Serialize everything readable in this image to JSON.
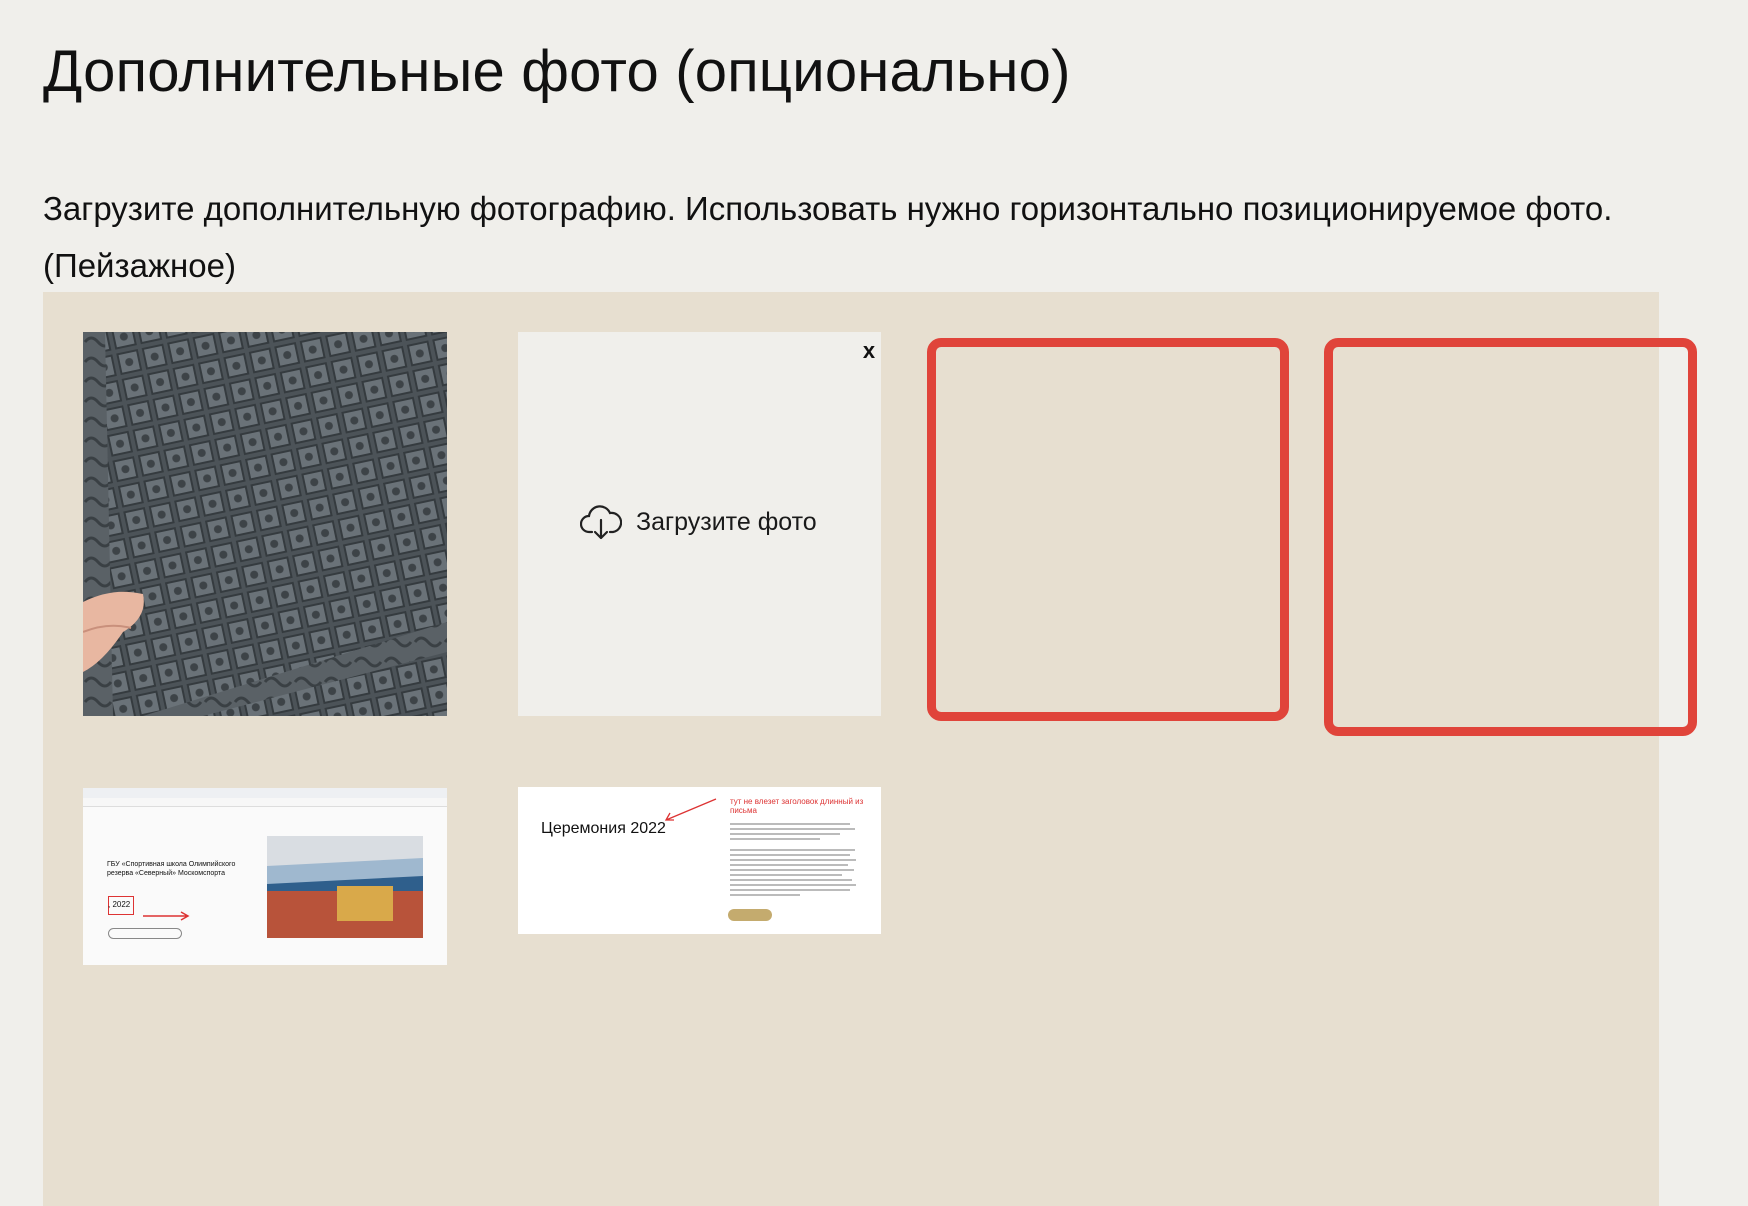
{
  "section": {
    "title": "Дополнительные фото (опционально)",
    "description": "Загрузите дополнительную фотографию. Использовать нужно горизонтально позиционируемое фото. (Пейзажное)"
  },
  "upload_slot": {
    "label": "Загрузите фото",
    "close_label": "x"
  },
  "thumbnails": {
    "screenshot_site": {
      "heading_line1": "ГБУ «Спортивная школа Олимпийского",
      "heading_line2": "резерва «Северный» Москомспорта",
      "year_label": ", 2022"
    },
    "screenshot_ceremony": {
      "title": "Церемония 2022",
      "annotation": "тут не влезет заголовок длинный из письма"
    }
  },
  "colors": {
    "page_bg": "#f0efeb",
    "panel_bg": "#e7dfd0",
    "annotation_red": "#e0443a"
  }
}
